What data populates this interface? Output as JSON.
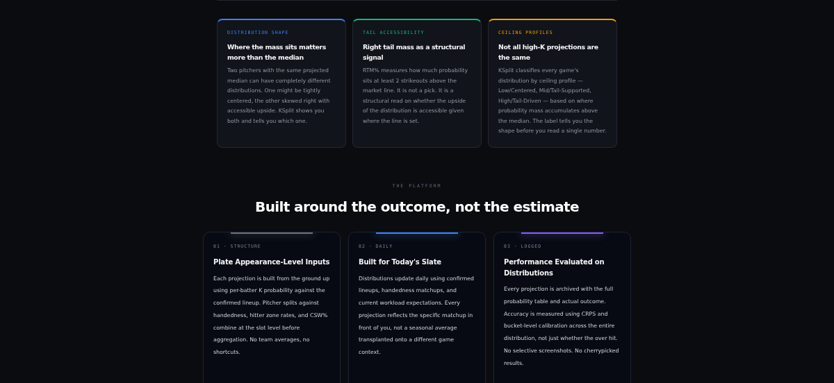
{
  "insights": [
    {
      "tag": "DISTRIBUTION SHAPE",
      "color": "#3b82f6",
      "title": "Where the mass sits matters more than the median",
      "body": "Two pitchers with the same projected median can have completely different distributions. One might be tightly centered, the other skewed right with accessible upside. KSplit shows you both and tells you which one."
    },
    {
      "tag": "TAIL ACCESSIBILITY",
      "color": "#10b981",
      "title": "Right tail mass as a structural signal",
      "body": "RTM% measures how much probability sits at least 2 strikeouts above the market line. It is not a pick. It is a structural read on whether the upside of the distribution is accessible given where the line is set."
    },
    {
      "tag": "CEILING PROFILES",
      "color": "#f59e0b",
      "title": "Not all high-K projections are the same",
      "body": "KSplit classifies every game's distribution by ceiling profile — Low/Centered, Mid/Tail-Supported, High/Tail-Driven — based on where probability mass accumulates above the median. The label tells you the shape before you read a single number."
    }
  ],
  "platform": {
    "eyebrow": "THE PLATFORM",
    "heading": "Built around the outcome, not the estimate",
    "cards": [
      {
        "tag": "01 · STRUCTURE",
        "color": "#6b7280",
        "title": "Plate Appearance-Level Inputs",
        "body": "Each projection is built from the ground up using per-batter K probability against the confirmed lineup. Pitcher splits against handedness, hitter zone rates, and CSW% combine at the slot level before aggregation. No team averages, no shortcuts."
      },
      {
        "tag": "02 · DAILY",
        "color": "#3b82f6",
        "title": "Built for Today's Slate",
        "body": "Distributions update daily using confirmed lineups, handedness matchups, and current workload expectations. Every projection reflects the specific matchup in front of you, not a seasonal average transplanted onto a different game context."
      },
      {
        "tag": "03 · LOGGED",
        "color": "#8b5cf6",
        "title": "Performance Evaluated on Distributions",
        "body": "Every projection is archived with the full probability table and actual outcome. Accuracy is measured using CRPS and bucket-level calibration across the entire distribution, not just whether the over hit. No selective screenshots. No cherrypicked results."
      }
    ]
  }
}
